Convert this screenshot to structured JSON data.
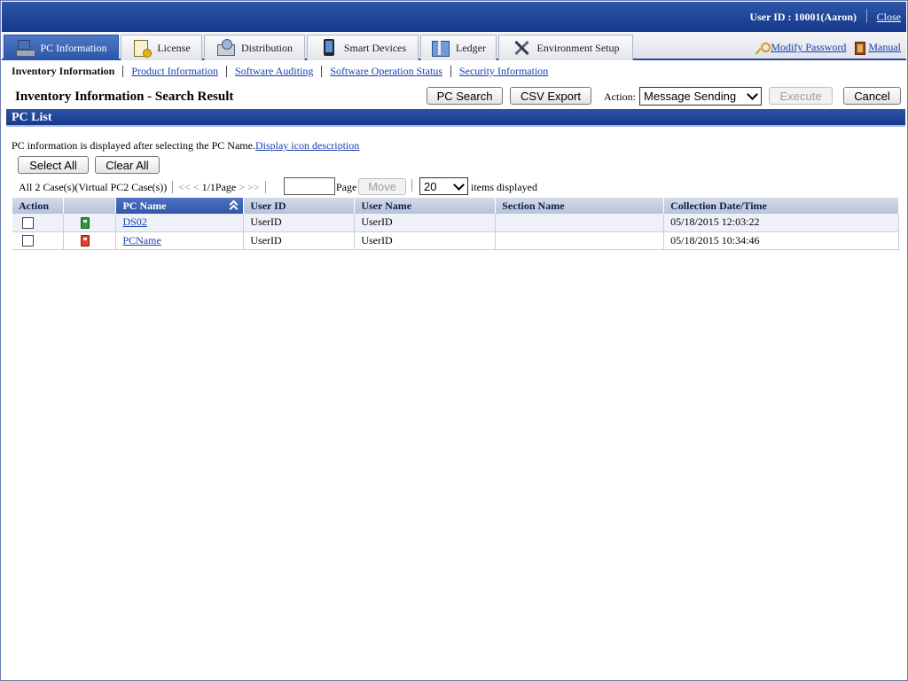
{
  "topbar": {
    "user_label": "User ID : 10001(Aaron)",
    "close_label": "Close"
  },
  "menu": {
    "tabs": [
      {
        "label": "PC Information",
        "icon": "pc-icon",
        "active": true
      },
      {
        "label": "License",
        "icon": "license-icon",
        "active": false
      },
      {
        "label": "Distribution",
        "icon": "distribution-icon",
        "active": false
      },
      {
        "label": "Smart Devices",
        "icon": "smart-device-icon",
        "active": false
      },
      {
        "label": "Ledger",
        "icon": "ledger-icon",
        "active": false
      },
      {
        "label": "Environment Setup",
        "icon": "tools-icon",
        "active": false
      }
    ],
    "modify_password": "Modify Password",
    "manual": "Manual"
  },
  "subnav": {
    "current": "Inventory Information",
    "links": [
      "Product Information",
      "Software Auditing",
      "Software Operation Status",
      "Security Information"
    ]
  },
  "page": {
    "title": "Inventory Information - Search Result",
    "pc_search": "PC Search",
    "csv_export": "CSV Export",
    "action_label": "Action:",
    "action_value": "Message Sending",
    "execute": "Execute",
    "cancel": "Cancel"
  },
  "section": {
    "title": "PC List",
    "info_text": "PC information is displayed after selecting the PC Name.",
    "info_link": "Display icon description",
    "select_all": "Select All",
    "clear_all": "Clear All"
  },
  "pager": {
    "summary": "All 2 Case(s)(Virtual PC2 Case(s))",
    "first": "<<",
    "prev": "<",
    "page_info": "1/1Page",
    "next": ">",
    "last": ">>",
    "page_input": "",
    "page_label": "Page",
    "move": "Move",
    "per_page": "20",
    "per_page_suffix": "items displayed"
  },
  "table": {
    "headers": [
      "Action",
      "",
      "PC Name",
      "User ID",
      "User Name",
      "Section Name",
      "Collection Date/Time"
    ],
    "rows": [
      {
        "status_color": "#2e9a3a",
        "pc_name": "DS02",
        "user_id": "UserID",
        "user_name": "UserID",
        "section": "",
        "collected": "05/18/2015 12:03:22"
      },
      {
        "status_color": "#e0432a",
        "pc_name": "PCName",
        "user_id": "UserID",
        "user_name": "UserID",
        "section": "",
        "collected": "05/18/2015 10:34:46"
      }
    ]
  },
  "colors": {
    "header_blue": "#15378a",
    "link_blue": "#1a3fb0"
  }
}
